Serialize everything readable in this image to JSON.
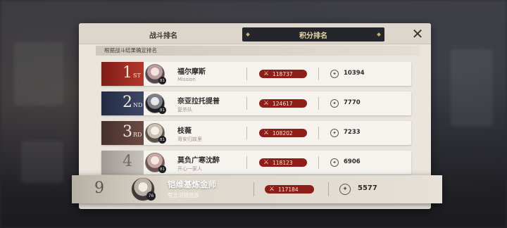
{
  "tabs": {
    "battle_ranking": "战斗排名",
    "score_ranking": "积分排名"
  },
  "subtitle": "根据战斗结果确定排名",
  "rows": [
    {
      "rank": "1",
      "suffix": "ST",
      "name": "福尔摩斯",
      "team": "Mission",
      "level": "81",
      "power": "118737",
      "score": "10394",
      "color": "#9e2a22"
    },
    {
      "rank": "2",
      "suffix": "ND",
      "name": "奈亚拉托提普",
      "team": "复杀队",
      "level": "81",
      "power": "124617",
      "score": "7770",
      "color": "#2f3a55"
    },
    {
      "rank": "3",
      "suffix": "RD",
      "name": "枝薇",
      "team": "哥安归故里",
      "level": "81",
      "power": "108202",
      "score": "7233",
      "color": "#5a3f39"
    },
    {
      "rank": "4",
      "suffix": "",
      "name": "莫负广寒沈醉",
      "team": "开心一家人",
      "level": "81",
      "power": "118123",
      "score": "6906",
      "color": "#b8b4ae"
    }
  ],
  "self": {
    "rank": "9",
    "name": "铠维基炼金师",
    "team": "莹吉诃德氏族",
    "level": "76",
    "power": "117184",
    "score": "5577"
  },
  "icons": {
    "close": "close-icon",
    "power": "crossed-swords-icon",
    "score": "score-medal-icon"
  }
}
